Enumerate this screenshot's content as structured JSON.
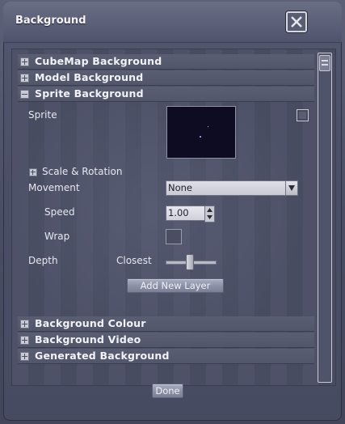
{
  "window": {
    "title": "Background"
  },
  "sections": {
    "cubemap": "CubeMap Background",
    "model": "Model Background",
    "sprite": "Sprite Background",
    "colour": "Background Colour",
    "video": "Background Video",
    "generated": "Generated Background"
  },
  "sprite_panel": {
    "sprite_label": "Sprite",
    "scale_rotation_label": "Scale & Rotation",
    "movement_label": "Movement",
    "movement_value": "None",
    "speed_label": "Speed",
    "speed_value": "1.00",
    "wrap_label": "Wrap",
    "depth_label": "Depth",
    "depth_value_label": "Closest",
    "add_layer_label": "Add New Layer"
  },
  "footer": {
    "done_label": "Done"
  },
  "icons": {
    "close": "close-icon",
    "expand": "plus-icon",
    "collapse": "minus-icon",
    "dropdown": "chevron-down-icon"
  }
}
